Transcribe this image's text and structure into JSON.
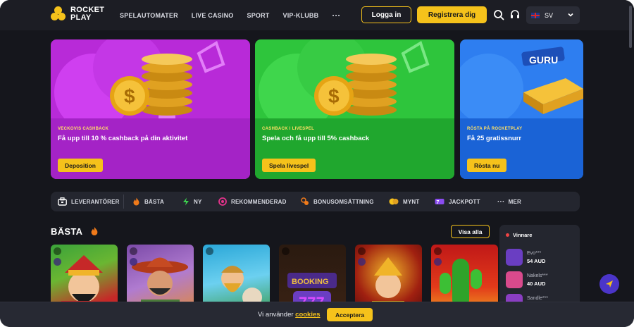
{
  "brand": {
    "line1": "ROCKET",
    "line2": "PLAY",
    "color": "#f5c21b"
  },
  "nav": {
    "items": [
      "SPELAUTOMATER",
      "LIVE CASINO",
      "SPORT",
      "VIP-KLUBB"
    ],
    "more_icon": "ellipsis-icon"
  },
  "header": {
    "login_label": "Logga in",
    "register_label": "Registrera dig",
    "search_icon": "search-icon",
    "support_icon": "headset-icon",
    "language": "SV",
    "language_flag": "uk-flag-icon"
  },
  "promos": [
    {
      "kicker": "VECKOVIS CASHBACK",
      "heading": "Få upp till 10 % cashback på din aktivitet",
      "cta": "Deposition",
      "color": "#b82ad8"
    },
    {
      "kicker": "CASHBACK I LIVESPEL",
      "heading": "Spela och få upp till 5% cashback",
      "cta": "Spela livespel",
      "color": "#2ec53c"
    },
    {
      "kicker": "RÖSTA PÅ ROCKETPLAY",
      "heading": "Få 25 gratissnurr",
      "cta": "Rösta nu",
      "color": "#2e7ef0",
      "art_label": "GURU"
    }
  ],
  "categories": [
    {
      "label": "LEVERANTÖRER",
      "icon": "provider-icon"
    },
    {
      "label": "BÄSTA",
      "icon": "fire-icon"
    },
    {
      "label": "NY",
      "icon": "lightning-icon"
    },
    {
      "label": "REKOMMENDERAD",
      "icon": "recommend-icon"
    },
    {
      "label": "BONUSOMSÄTTNING",
      "icon": "bonus-icon"
    },
    {
      "label": "MYNT",
      "icon": "coins-icon"
    },
    {
      "label": "JACKPOTT",
      "icon": "jackpot-icon"
    },
    {
      "label": "MER",
      "icon": "ellipsis-icon"
    }
  ],
  "section": {
    "title": "BÄSTA",
    "view_all": "Visa alla"
  },
  "games": [
    {
      "name": "game-fortune-god",
      "colors": [
        "#3aa33a",
        "#c62828"
      ]
    },
    {
      "name": "game-cowboy",
      "colors": [
        "#7b4aa8",
        "#b23a1a"
      ]
    },
    {
      "name": "game-viking",
      "colors": [
        "#2aa7d8",
        "#e3a62a"
      ]
    },
    {
      "name": "game-book-777",
      "colors": [
        "#2a1a10",
        "#6a3ec2"
      ]
    },
    {
      "name": "game-golden-god",
      "colors": [
        "#7a1010",
        "#f0b429"
      ]
    },
    {
      "name": "game-cactus",
      "colors": [
        "#c01818",
        "#2fa32a"
      ]
    }
  ],
  "winners": {
    "title": "Vinnare",
    "list": [
      {
        "name": "Evo***",
        "amount": "54 AUD",
        "color": "#6a3ec2"
      },
      {
        "name": "Nakels***",
        "amount": "40 AUD",
        "color": "#d94a8c"
      },
      {
        "name": "Sandle***",
        "amount": "",
        "color": "#8a3ec2"
      }
    ]
  },
  "cookie": {
    "text": "Vi använder",
    "link": "cookies",
    "accept": "Acceptera"
  }
}
